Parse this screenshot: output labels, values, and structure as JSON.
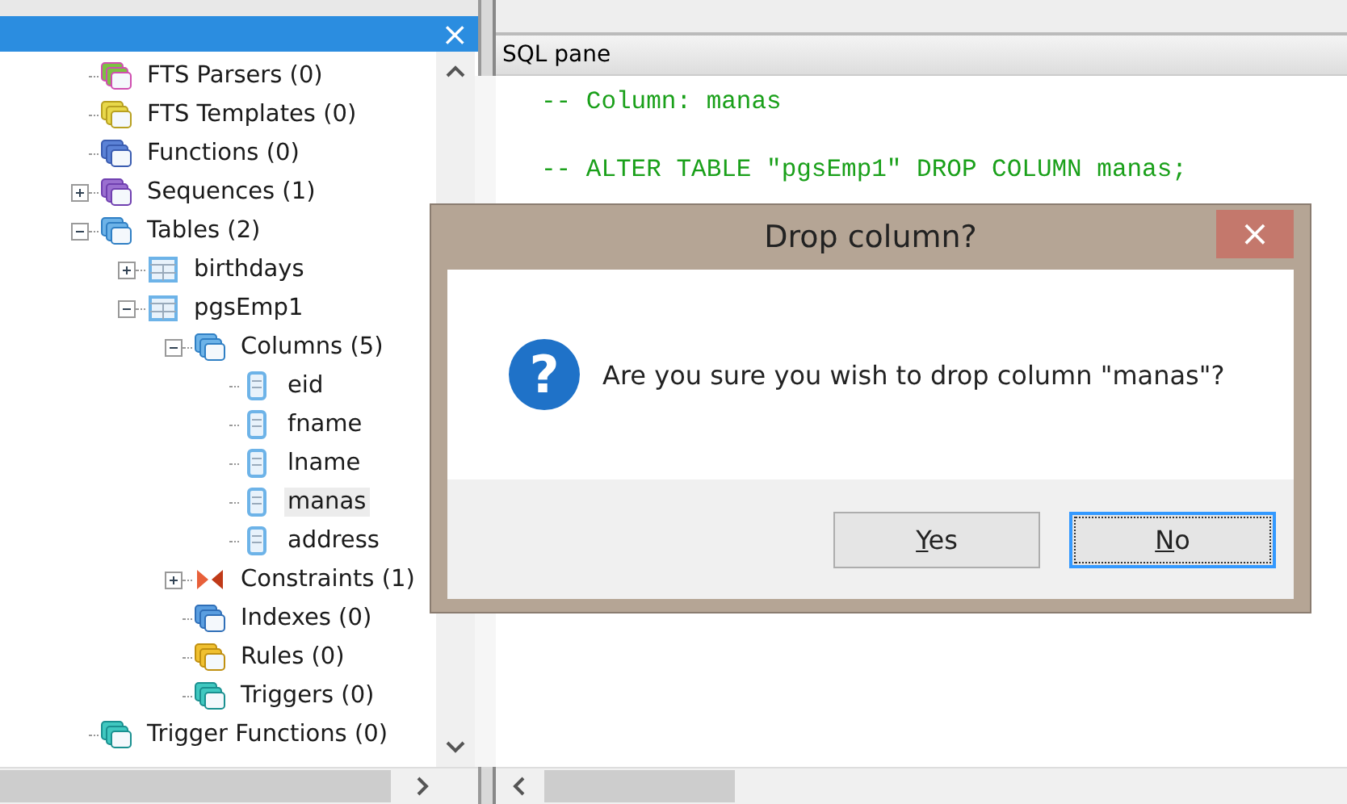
{
  "browser": {
    "close_symbol": "×",
    "tree": [
      {
        "label": "FTS Parsers (0)",
        "kind": "parsers",
        "selected": false
      },
      {
        "label": "FTS Templates (0)",
        "kind": "templates",
        "selected": false
      },
      {
        "label": "Functions (0)",
        "kind": "functions",
        "selected": false
      },
      {
        "label": "Sequences (1)",
        "kind": "sequences",
        "expanded": false,
        "selected": false
      },
      {
        "label": "Tables (2)",
        "kind": "tables",
        "expanded": true,
        "selected": false,
        "children": [
          {
            "label": "birthdays",
            "kind": "table",
            "expanded": false,
            "selected": false
          },
          {
            "label": "pgsEmp1",
            "kind": "table",
            "expanded": true,
            "selected": false,
            "children": [
              {
                "label": "Columns (5)",
                "kind": "columns",
                "expanded": true,
                "selected": false,
                "children": [
                  {
                    "label": "eid",
                    "kind": "column",
                    "selected": false
                  },
                  {
                    "label": "fname",
                    "kind": "column",
                    "selected": false
                  },
                  {
                    "label": "lname",
                    "kind": "column",
                    "selected": false
                  },
                  {
                    "label": "manas",
                    "kind": "column",
                    "selected": true
                  },
                  {
                    "label": "address",
                    "kind": "column",
                    "selected": false
                  }
                ]
              },
              {
                "label": "Constraints (1)",
                "kind": "constraints",
                "expanded": false,
                "selected": false
              },
              {
                "label": "Indexes (0)",
                "kind": "indexes",
                "selected": false
              },
              {
                "label": "Rules (0)",
                "kind": "rules",
                "selected": false
              },
              {
                "label": "Triggers (0)",
                "kind": "triggers",
                "selected": false
              }
            ]
          }
        ]
      },
      {
        "label": "Trigger Functions (0)",
        "kind": "triggers",
        "selected": false
      }
    ]
  },
  "sql_pane": {
    "title": "SQL pane",
    "lines": [
      "-- Column: manas",
      "-- ALTER TABLE \"pgsEmp1\" DROP COLUMN manas;"
    ]
  },
  "dialog": {
    "title": "Drop column?",
    "close_symbol": "×",
    "message": "Are you sure you wish to drop column \"manas\"?",
    "icon_symbol": "?",
    "buttons": [
      {
        "label": "Yes",
        "focused": false
      },
      {
        "label": "No",
        "focused": true
      }
    ]
  }
}
